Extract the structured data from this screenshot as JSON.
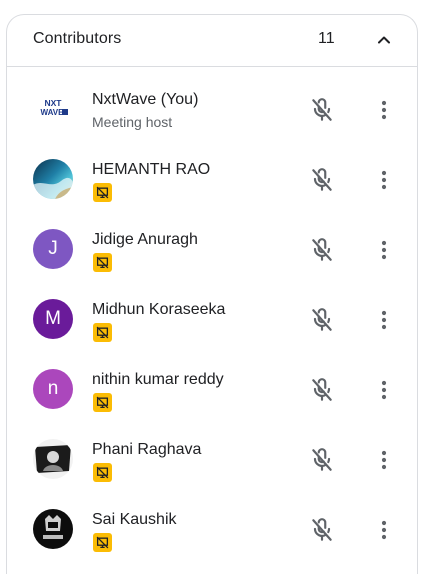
{
  "panel": {
    "title": "Contributors",
    "count": "11",
    "collapse_icon": "chevron-up-icon"
  },
  "participants": [
    {
      "name": "NxtWave (You)",
      "subtitle": "Meeting host",
      "avatar_type": "logo",
      "avatar_text": "NXT WAVE",
      "has_badge": false
    },
    {
      "name": "HEMANTH RAO",
      "subtitle": "",
      "avatar_type": "photo-coast",
      "avatar_text": "",
      "has_badge": true
    },
    {
      "name": "Jidige Anuragh",
      "subtitle": "",
      "avatar_type": "letter",
      "avatar_text": "J",
      "avatar_color": "#7e57c2",
      "has_badge": true
    },
    {
      "name": "Midhun Koraseeka",
      "subtitle": "",
      "avatar_type": "letter",
      "avatar_text": "M",
      "avatar_color": "#6a1b9a",
      "has_badge": true
    },
    {
      "name": "nithin kumar reddy",
      "subtitle": "",
      "avatar_type": "letter",
      "avatar_text": "n",
      "avatar_color": "#ab47bc",
      "has_badge": true
    },
    {
      "name": "Phani Raghava",
      "subtitle": "",
      "avatar_type": "photo-bw",
      "avatar_text": "",
      "has_badge": true
    },
    {
      "name": "Sai Kaushik",
      "subtitle": "",
      "avatar_type": "photo-dark",
      "avatar_text": "",
      "has_badge": true
    }
  ],
  "icons": {
    "mic": "mic-off-icon",
    "more": "more-vert-icon",
    "badge": "presentation-off-icon"
  },
  "colors": {
    "badge": "#fbbc04",
    "border": "#dadce0",
    "text_primary": "#202124",
    "text_secondary": "#5f6368",
    "icon": "#5f6368"
  }
}
